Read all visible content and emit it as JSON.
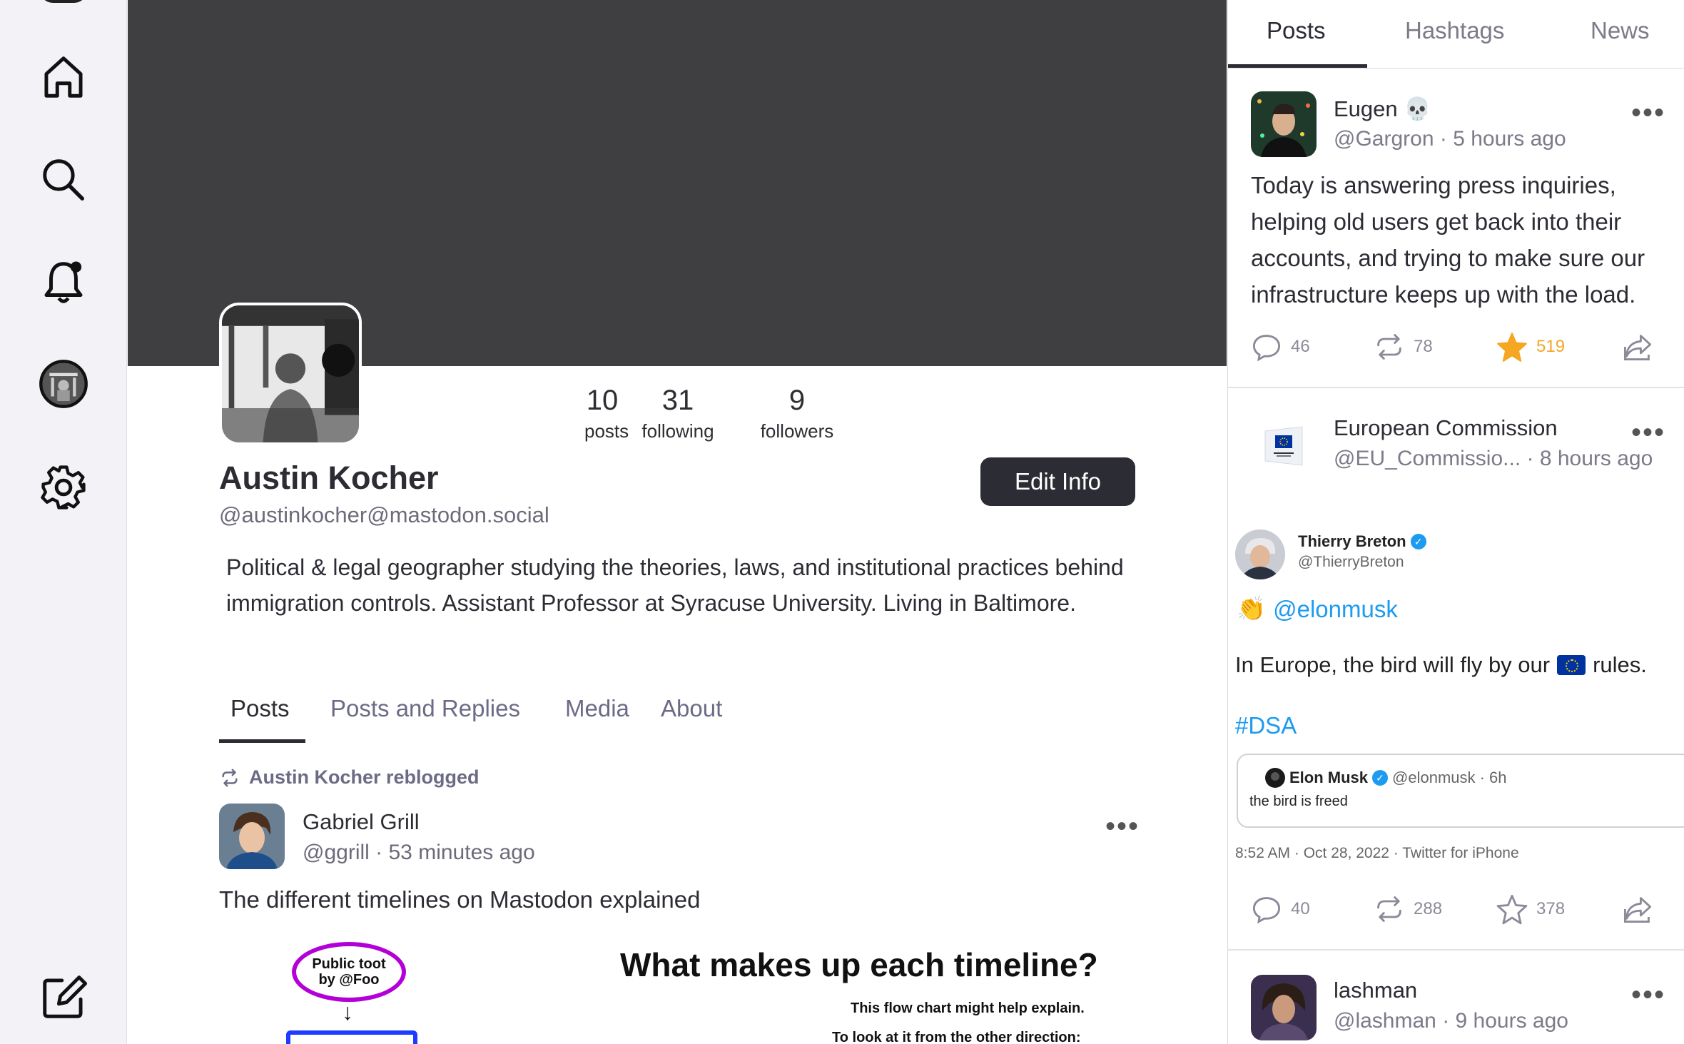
{
  "sidebar": {
    "items": [
      {
        "icon": "home-icon"
      },
      {
        "icon": "search-icon"
      },
      {
        "icon": "notifications-bell-icon"
      },
      {
        "icon": "profile-avatar"
      },
      {
        "icon": "settings-gear-icon"
      },
      {
        "icon": "compose-icon"
      }
    ]
  },
  "profile": {
    "display_name": "Austin Kocher",
    "handle": "@austinkocher@mastodon.social",
    "bio": "Political & legal geographer studying the theories, laws, and institutional practices behind immigration controls. Assistant Professor at Syracuse University. Living in Baltimore.",
    "stats": [
      {
        "value": "10",
        "label": "posts"
      },
      {
        "value": "31",
        "label": "following"
      },
      {
        "value": "9",
        "label": "followers"
      }
    ],
    "edit_button": "Edit Info",
    "tabs": [
      "Posts",
      "Posts and Replies",
      "Media",
      "About"
    ],
    "active_tab": "Posts"
  },
  "profile_post": {
    "reblog_text": "Austin Kocher reblogged",
    "author_name": "Gabriel Grill",
    "author_handle": "@ggrill",
    "separator": "·",
    "time": "53 minutes ago",
    "more": "•••",
    "text": "The different timelines on Mastodon explained",
    "image": {
      "bubble_line1": "Public toot",
      "bubble_line2": "by @Foo",
      "arrow": "↓",
      "title": "What makes up each timeline?",
      "sub1": "This flow chart might help explain.",
      "sub2": "To look at it from the other direction:"
    }
  },
  "right_panel": {
    "tabs": [
      "Posts",
      "Hashtags",
      "News"
    ],
    "active_tab": "Posts",
    "posts": [
      {
        "name": "Eugen",
        "emoji": "💀",
        "handle": "@Gargron",
        "time": "5 hours ago",
        "text": "Today is answering press inquiries, helping old users get back into their accounts, and trying to make sure our infrastructure keeps up with the load.",
        "replies": "46",
        "boosts": "78",
        "favourites": "519",
        "favourited": true
      },
      {
        "name": "European Commission",
        "handle": "@EU_Commissio...",
        "time": "8 hours ago",
        "embed": {
          "name": "Thierry Breton",
          "handle": "@ThierryBreton",
          "clap": "👏",
          "mention": "@elonmusk",
          "text_before": "In Europe, the bird will fly by our",
          "text_after": "rules.",
          "hashtag": "#DSA",
          "quote_name": "Elon Musk",
          "quote_meta": "@elonmusk · 6h",
          "quote_text": "the bird is freed",
          "footer": "8:52 AM · Oct 28, 2022 · Twitter for iPhone"
        },
        "replies": "40",
        "boosts": "288",
        "favourites": "378",
        "favourited": false
      },
      {
        "name": "lashman",
        "handle": "@lashman",
        "time": "9 hours ago"
      }
    ]
  },
  "colors": {
    "banner": "#3f3f41",
    "accent_dark": "#2c2c34",
    "favourite": "#f5a623",
    "link": "#1d9bf0",
    "bubble": "#b400d8",
    "box": "#1e3cff"
  }
}
